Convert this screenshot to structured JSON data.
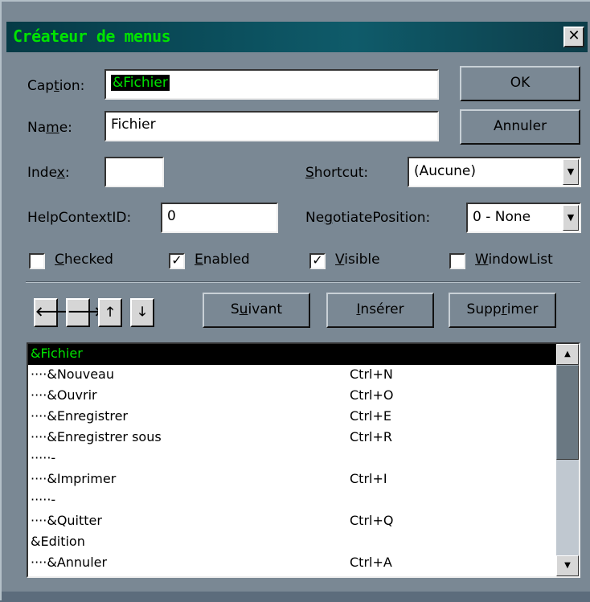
{
  "window": {
    "title": "Créateur de menus",
    "close_glyph": "✕"
  },
  "fields": {
    "caption": {
      "label_pre": "Cap",
      "label_u": "t",
      "label_post": "ion:",
      "value": "&Fichier"
    },
    "name": {
      "label_pre": "Na",
      "label_u": "m",
      "label_post": "e:",
      "value": "Fichier"
    },
    "index": {
      "label_pre": "Inde",
      "label_u": "x",
      "label_post": ":",
      "value": ""
    },
    "shortcut": {
      "label_u": "S",
      "label_post": "hortcut:",
      "value": "(Aucune)"
    },
    "helpcontext": {
      "label": "HelpContextID:",
      "value": "0"
    },
    "negotiate": {
      "label_pre": "Ne",
      "label_u": "g",
      "label_post": "otiatePosition:",
      "value": "0 - None"
    }
  },
  "buttons": {
    "ok": "OK",
    "annuler": "Annuler",
    "suivant_pre": "S",
    "suivant_u": "u",
    "suivant_post": "ivant",
    "inserer_u": "I",
    "inserer_post": "nsérer",
    "supprimer_pre": "Supp",
    "supprimer_u": "r",
    "supprimer_post": "imer"
  },
  "checkboxes": {
    "checked": {
      "label_u": "C",
      "label_post": "hecked",
      "state": false
    },
    "enabled": {
      "label_u": "E",
      "label_post": "nabled",
      "state": true
    },
    "visible": {
      "label_u": "V",
      "label_post": "isible",
      "state": true
    },
    "windowlist": {
      "label_u": "W",
      "label_post": "indowList",
      "state": false
    }
  },
  "arrows": {
    "left": "🡐",
    "right": "🡒",
    "up": "🡑",
    "down": "🡓"
  },
  "menu_items": [
    {
      "caption": "&Fichier",
      "shortcut": "",
      "selected": true
    },
    {
      "caption": "····&Nouveau",
      "shortcut": "Ctrl+N"
    },
    {
      "caption": "····&Ouvrir",
      "shortcut": "Ctrl+O"
    },
    {
      "caption": "····&Enregistrer",
      "shortcut": "Ctrl+E"
    },
    {
      "caption": "····&Enregistrer sous",
      "shortcut": "Ctrl+R"
    },
    {
      "caption": "·····-",
      "shortcut": ""
    },
    {
      "caption": "····&Imprimer",
      "shortcut": "Ctrl+I"
    },
    {
      "caption": "·····-",
      "shortcut": ""
    },
    {
      "caption": "····&Quitter",
      "shortcut": "Ctrl+Q"
    },
    {
      "caption": "&Edition",
      "shortcut": ""
    },
    {
      "caption": "····&Annuler",
      "shortcut": "Ctrl+A"
    }
  ],
  "colors": {
    "accent_green": "#00e300",
    "dialog_bg": "#7a8894"
  }
}
